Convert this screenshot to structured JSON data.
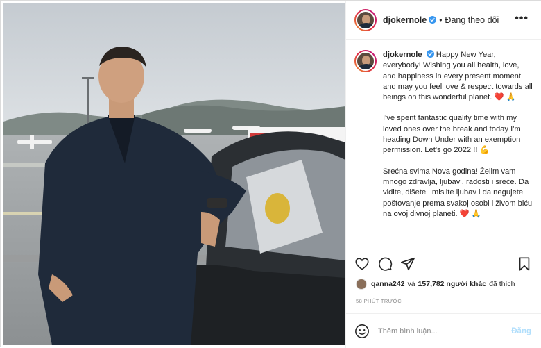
{
  "header": {
    "username": "djokernole",
    "separator": "•",
    "follow_status": "Đang theo dõi",
    "more_icon": "more-horizontal-icon"
  },
  "caption": {
    "username": "djokernole",
    "paragraphs": [
      "Happy New Year, everybody! Wishing you all health, love, and happiness in every present moment and may you feel love & respect towards all beings on this wonderful planet. ❤️ 🙏",
      "I've spent fantastic quality time with my loved ones over the break and today I'm heading Down Under with an exemption permission. Let's go 2022 !! 💪",
      "Srećna svima Nova godina! Želim vam mnogo zdravlja, ljubavi, radosti i sreće. Da vidite, dišete i mislite ljubav i da negujete poštovanje prema svakoj osobi i živom biću na ovoj divnoj planeti. ❤️ 🙏"
    ]
  },
  "actions": {
    "like_icon": "heart-icon",
    "comment_icon": "comment-icon",
    "share_icon": "share-icon",
    "save_icon": "bookmark-icon"
  },
  "likes": {
    "liker": "qanna242",
    "connector": "và",
    "others": "157,782 người khác",
    "suffix": "đã thích"
  },
  "timestamp": "58 PHÚT TRƯỚC",
  "comment_box": {
    "placeholder": "Thêm bình luận...",
    "post_label": "Đăng",
    "emoji_icon": "emoji-icon"
  },
  "colors": {
    "verified": "#3897f0",
    "heart": "#e0245e",
    "post_button_disabled": "#b2dffc",
    "muted_text": "#8e8e8e"
  }
}
